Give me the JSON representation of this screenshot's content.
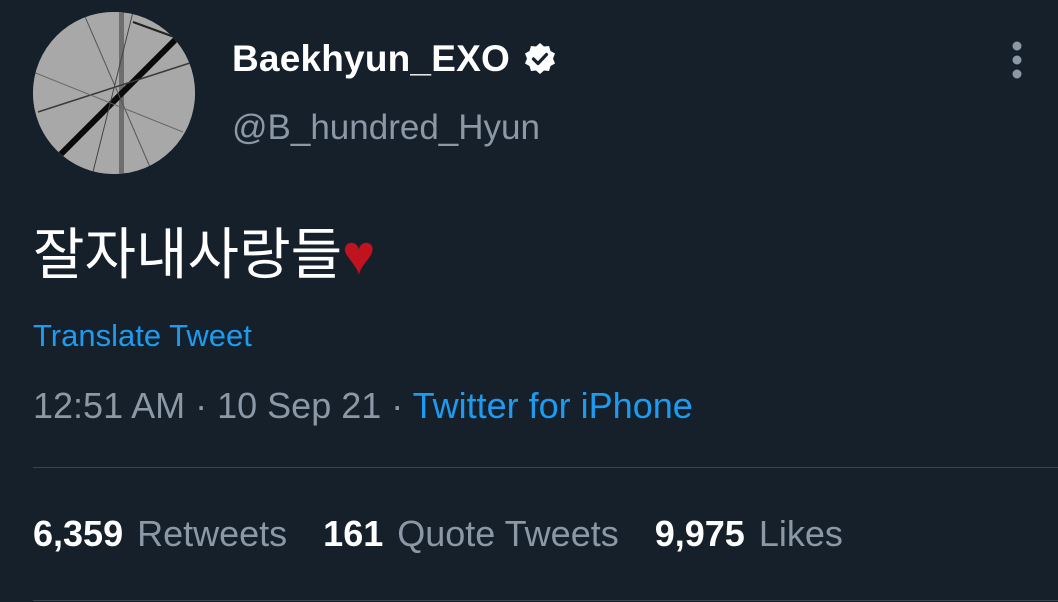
{
  "user": {
    "display_name": "Baekhyun_EXO",
    "handle": "@B_hundred_Hyun",
    "verified_icon": "verified-badge-icon",
    "avatar_icon": "avatar-image"
  },
  "tweet": {
    "text": "잘자내사랑들",
    "emoji": "♥",
    "translate_label": "Translate Tweet",
    "time": "12:51 AM",
    "separator": "·",
    "date": "10 Sep 21",
    "source": "Twitter for iPhone"
  },
  "stats": {
    "retweets_count": "6,359",
    "retweets_label": "Retweets",
    "quotes_count": "161",
    "quotes_label": "Quote Tweets",
    "likes_count": "9,975",
    "likes_label": "Likes"
  },
  "icons": {
    "more": "more-vertical-icon"
  },
  "colors": {
    "background": "#15202b",
    "accent": "#1d9bf0",
    "secondary_text": "#8b98a5",
    "heart": "#c1121f"
  }
}
